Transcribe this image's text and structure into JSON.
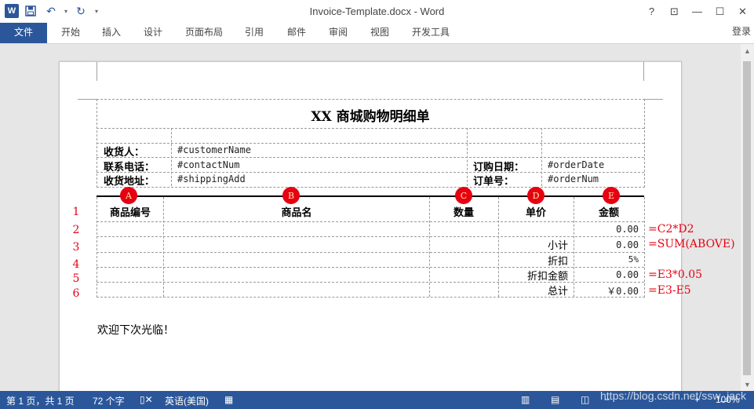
{
  "titlebar": {
    "title": "Invoice-Template.docx - Word",
    "app_logo": "W",
    "save_icon": "save-icon",
    "undo_icon": "undo-icon",
    "redo_icon": "redo-icon",
    "help": "?",
    "restore_ribbon": "⊡",
    "minimize": "—",
    "maximize": "☐",
    "close": "✕"
  },
  "ribbon": {
    "tabs": [
      "文件",
      "开始",
      "插入",
      "设计",
      "页面布局",
      "引用",
      "邮件",
      "审阅",
      "视图",
      "开发工具"
    ],
    "login": "登录"
  },
  "document": {
    "title": "XX 商城购物明细单",
    "info": {
      "receiver_label": "收货人：",
      "receiver_value": "#customerName",
      "phone_label": "联系电话：",
      "phone_value": "#contactNum",
      "address_label": "收货地址：",
      "address_value": "#shippingAdd",
      "date_label": "订购日期：",
      "date_value": "#orderDate",
      "order_label": "订单号：",
      "order_value": "#orderNum"
    },
    "columns": [
      "商品编号",
      "商品名",
      "数量",
      "单价",
      "金额"
    ],
    "column_letters": [
      "A",
      "B",
      "C",
      "D",
      "E"
    ],
    "row_numbers": [
      "1",
      "2",
      "3",
      "4",
      "5",
      "6"
    ],
    "rows": [
      {
        "label": "",
        "value": "0.00"
      },
      {
        "label": "小计",
        "value": "0.00"
      },
      {
        "label": "折扣",
        "value": "5%"
      },
      {
        "label": "折扣金额",
        "value": "0.00"
      },
      {
        "label": "总计",
        "value": "￥0.00"
      }
    ],
    "formulas": [
      "=C2*D2",
      "=SUM(ABOVE)",
      "=E3*0.05",
      "=E3-E5"
    ],
    "footer_text": "欢迎下次光临！"
  },
  "status": {
    "page": "第 1 页，共 1 页",
    "words": "72 个字",
    "language": "英语(美国)",
    "zoom": "100%"
  },
  "watermark": "https://blog.csdn.net/ssw_jack",
  "colors": {
    "accent": "#2b579a",
    "annotation_red": "#e60012"
  }
}
